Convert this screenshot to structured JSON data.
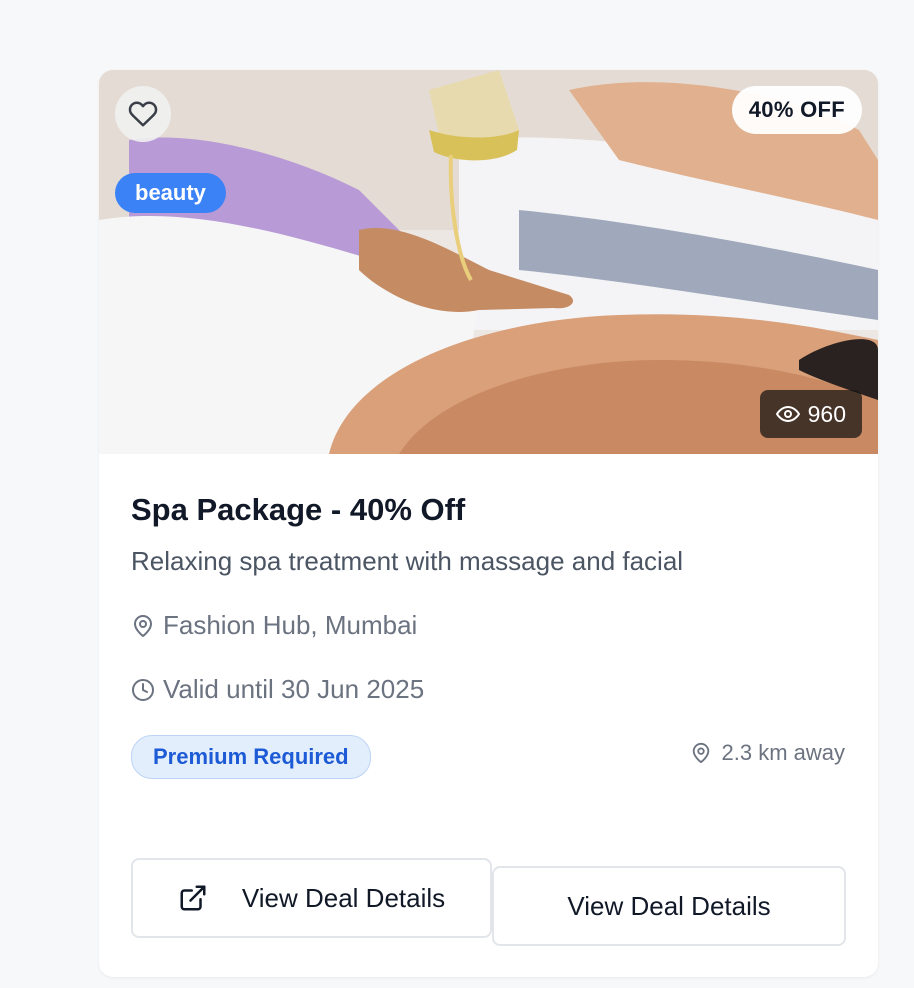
{
  "deal": {
    "category": "beauty",
    "discount_badge": "40% OFF",
    "views": "960",
    "title": "Spa Package - 40% Off",
    "description": "Relaxing spa treatment with massage and facial",
    "location": "Fashion Hub, Mumbai",
    "validity": "Valid until 30 Jun 2025",
    "premium_label": "Premium Required",
    "distance": "2.3 km away",
    "primary_action": "View Deal Details",
    "secondary_action": "View Deal Details"
  },
  "icons": {
    "favorite": "heart-icon",
    "views": "eye-icon",
    "location": "map-pin-icon",
    "validity": "clock-icon",
    "distance": "map-pin-icon",
    "primary_action": "external-link-icon"
  },
  "colors": {
    "category_chip": "#3b82f6",
    "premium_badge_bg": "#e3eefd",
    "premium_badge_text": "#1d5bd6",
    "views_bg": "#141414"
  }
}
